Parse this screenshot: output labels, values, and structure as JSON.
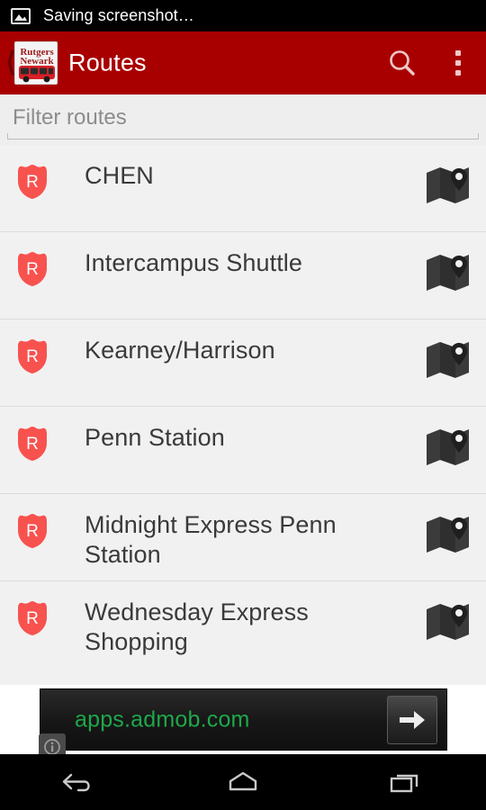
{
  "status_bar": {
    "icon": "image-saving-icon",
    "text": "Saving screenshot…"
  },
  "action_bar": {
    "up_icon": "back-chevron-icon",
    "app_icon": "rutgers-newark-bus-app-icon",
    "app_icon_line1": "Rutgers",
    "app_icon_line2": "Newark",
    "title": "Routes",
    "search_icon": "search-icon",
    "overflow_icon": "overflow-menu-icon",
    "background_color": "#a80000",
    "title_color": "#ffffff"
  },
  "filter": {
    "placeholder": "Filter routes",
    "value": ""
  },
  "routes": {
    "shield_icon": "route-shield-icon",
    "shield_letter": "R",
    "shield_color": "#f8524f",
    "map_icon": "map-with-pin-icon",
    "items": [
      {
        "name": "CHEN"
      },
      {
        "name": "Intercampus Shuttle"
      },
      {
        "name": "Kearney/Harrison"
      },
      {
        "name": "Penn Station"
      },
      {
        "name": "Midnight Express Penn Station"
      },
      {
        "name": "Wednesday Express Shopping"
      }
    ]
  },
  "ad": {
    "url_text": "apps.admob.com",
    "url_color": "#1ea84a",
    "info_icon": "ad-info-icon",
    "arrow_icon": "arrow-right-icon"
  },
  "nav_bar": {
    "back_icon": "back-icon",
    "home_icon": "home-icon",
    "recents_icon": "recents-icon"
  }
}
